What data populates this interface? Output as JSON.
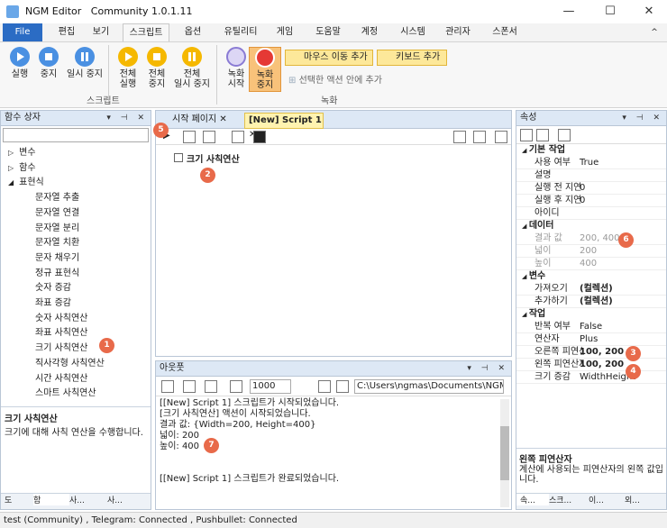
{
  "window": {
    "app_name": "NGM Editor",
    "edition": "Community 1.0.1.11",
    "min": "—",
    "max": "☐",
    "close": "✕"
  },
  "ribbon_tabs": [
    "File",
    "편집",
    "보기",
    "스크립트",
    "옵션",
    "유틸리티",
    "게임",
    "도움말",
    "계정",
    "시스템",
    "관리자",
    "스폰서"
  ],
  "ribbon_collapse": "^",
  "script_group": {
    "label": "스크립트",
    "buttons": [
      "실행",
      "중지",
      "일시 중지"
    ],
    "all_buttons": [
      "전체\n실행",
      "전체\n중지",
      "전체\n일시 중지"
    ]
  },
  "record_group": {
    "label": "녹화",
    "record": "녹화\n시작",
    "stop": "녹화\n중지",
    "mouse_move": "마우스 이동 추가",
    "keyboard": "키보드 추가",
    "add_to_selected": "선택한 액션 안에 추가"
  },
  "colors": {
    "accent": "#2b6cc4",
    "badge": "#e86a4a",
    "panel_head": "#dde8f5",
    "record_red": "#e53935",
    "yellow": "#fde89a"
  },
  "function_panel": {
    "title": "함수 상자",
    "tree": [
      {
        "label": "변수",
        "level": 0,
        "expander": "▷"
      },
      {
        "label": "함수",
        "level": 0,
        "expander": "▷"
      },
      {
        "label": "표현식",
        "level": 0,
        "expander": "◢"
      },
      {
        "label": "문자열 추출",
        "level": 1
      },
      {
        "label": "문자열 연결",
        "level": 1
      },
      {
        "label": "문자열 분리",
        "level": 1
      },
      {
        "label": "문자열 치환",
        "level": 1
      },
      {
        "label": "문자 채우기",
        "level": 1
      },
      {
        "label": "정규 표현식",
        "level": 1
      },
      {
        "label": "숫자 증감",
        "level": 1
      },
      {
        "label": "좌표 증감",
        "level": 1
      },
      {
        "label": "숫자 사칙연산",
        "level": 1
      },
      {
        "label": "좌표 사칙연산",
        "level": 1
      },
      {
        "label": "크기 사칙연산",
        "level": 1
      },
      {
        "label": "직사각형 사칙연산",
        "level": 1
      },
      {
        "label": "시간 사칙연산",
        "level": 1
      },
      {
        "label": "스마트 사칙연산",
        "level": 1
      }
    ],
    "desc_title": "크기 사칙연산",
    "desc_text": "크기에 대해 사칙 연산을 수행합니다.",
    "bottom_tabs": [
      "도",
      "함",
      "사...",
      "사..."
    ]
  },
  "editor": {
    "tabs": [
      "시작 페이지",
      "[New] Script 1"
    ],
    "root_item": "크기 사칙연산"
  },
  "output": {
    "title": "아웃풋",
    "count": "1000",
    "path": "C:\\Users\\ngmas\\Documents\\NGM5\\",
    "lines": [
      "[[New] Script 1] 스크립트가 시작되었습니다.",
      "[크기 사칙연산] 액션이 시작되었습니다.",
      "결과 값: {Width=200, Height=400}",
      "넓이: 200",
      "높이: 400",
      "",
      "",
      "[[New] Script 1] 스크립트가 완료되었습니다."
    ]
  },
  "properties": {
    "title": "속성",
    "sections": [
      {
        "name": "기본 작업",
        "rows": [
          [
            "사용 여부",
            "True"
          ],
          [
            "설명",
            ""
          ],
          [
            "실행 전 지연",
            "0"
          ],
          [
            "실행 후 지연",
            "0"
          ],
          [
            "아이디",
            ""
          ]
        ]
      },
      {
        "name": "데이터",
        "rows": [
          [
            "결과 값",
            "200, 400"
          ],
          [
            "넓이",
            "200"
          ],
          [
            "높이",
            "400"
          ]
        ]
      },
      {
        "name": "변수",
        "rows": [
          [
            "가져오기",
            "(컬렉션)"
          ],
          [
            "추가하기",
            "(컬렉션)"
          ]
        ]
      },
      {
        "name": "작업",
        "rows": [
          [
            "반복 여부",
            "False"
          ],
          [
            "연산자",
            "Plus"
          ],
          [
            "오른쪽 피연산자",
            "100, 200"
          ],
          [
            "왼쪽 피연산자",
            "100, 200"
          ],
          [
            "크기 증감",
            "WidthHeight"
          ]
        ]
      }
    ],
    "desc_title": "왼쪽 피연산자",
    "desc_text": "계산에 사용되는 피연산자의 왼쪽 값입니다.",
    "bottom_tabs": [
      "속...",
      "스크...",
      "이...",
      "외..."
    ]
  },
  "badges": [
    "1",
    "2",
    "3",
    "4",
    "5",
    "6",
    "7"
  ],
  "status": "test (Community)  , Telegram: Connected  , Pushbullet: Connected"
}
